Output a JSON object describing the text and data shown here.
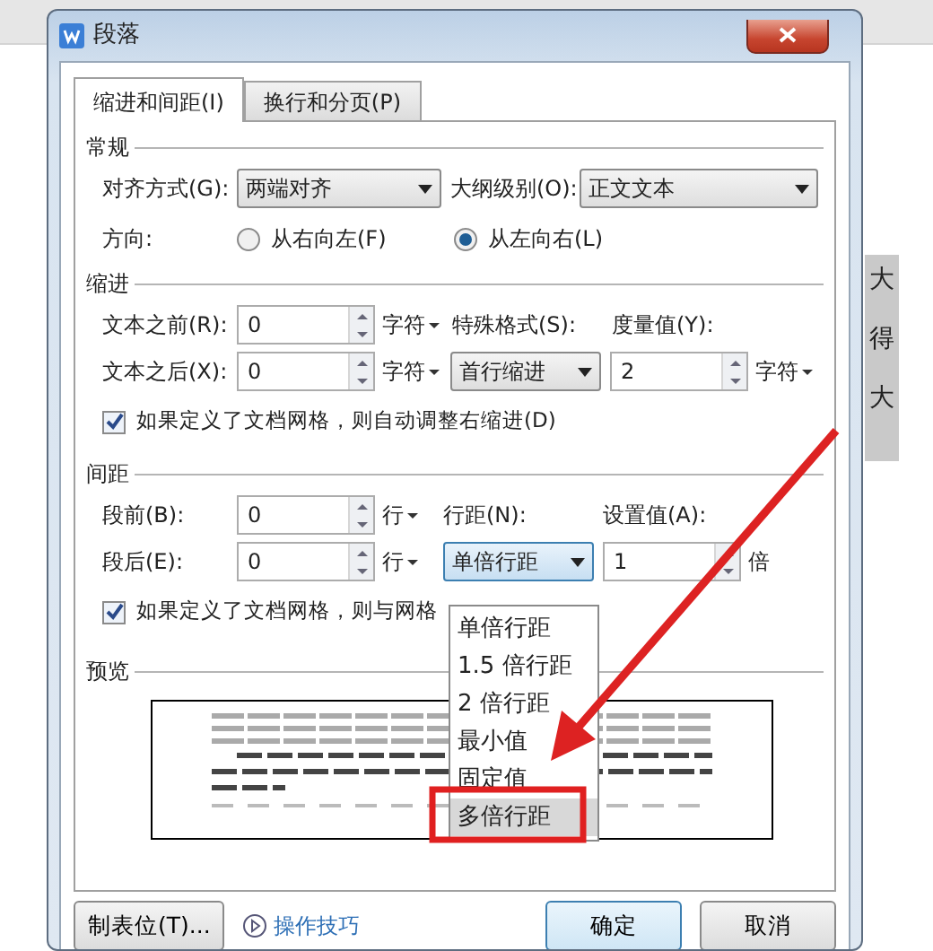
{
  "window": {
    "title": "段落"
  },
  "tabs": [
    {
      "label": "缩进和间距(I)",
      "selected": true
    },
    {
      "label": "换行和分页(P)",
      "selected": false
    }
  ],
  "general": {
    "heading": "常规",
    "alignment": {
      "label": "对齐方式(G):",
      "value": "两端对齐"
    },
    "outline": {
      "label": "大纲级别(O):",
      "value": "正文文本"
    },
    "direction": {
      "label": "方向:",
      "options": [
        {
          "label": "从右向左(F)",
          "selected": false
        },
        {
          "label": "从左向右(L)",
          "selected": true
        }
      ]
    }
  },
  "indent": {
    "heading": "缩进",
    "before": {
      "label": "文本之前(R):",
      "value": "0",
      "unit": "字符"
    },
    "after": {
      "label": "文本之后(X):",
      "value": "0",
      "unit": "字符"
    },
    "special": {
      "label": "特殊格式(S):",
      "value": "首行缩进"
    },
    "measure": {
      "label": "度量值(Y):",
      "value": "2",
      "unit": "字符"
    },
    "checkbox": {
      "label": "如果定义了文档网格，则自动调整右缩进(D)",
      "checked": true
    }
  },
  "spacing": {
    "heading": "间距",
    "before": {
      "label": "段前(B):",
      "value": "0",
      "unit": "行"
    },
    "after": {
      "label": "段后(E):",
      "value": "0",
      "unit": "行"
    },
    "line_spacing": {
      "label": "行距(N):",
      "value": "单倍行距",
      "options": [
        {
          "label": "单倍行距",
          "highlighted": false
        },
        {
          "label": "1.5 倍行距",
          "highlighted": false
        },
        {
          "label": "2 倍行距",
          "highlighted": false
        },
        {
          "label": "最小值",
          "highlighted": false
        },
        {
          "label": "固定值",
          "highlighted": false
        },
        {
          "label": "多倍行距",
          "highlighted": true
        }
      ]
    },
    "set_value": {
      "label": "设置值(A):",
      "value": "1",
      "unit": "倍"
    },
    "checkbox": {
      "label": "如果定义了文档网格，则与网格",
      "checked": true
    }
  },
  "preview": {
    "heading": "预览"
  },
  "footer": {
    "tabs_button": "制表位(T)...",
    "tips_link": "操作技巧",
    "ok": "确定",
    "cancel": "取消"
  },
  "document": {
    "side_chars": [
      "大",
      "得",
      "大"
    ]
  }
}
